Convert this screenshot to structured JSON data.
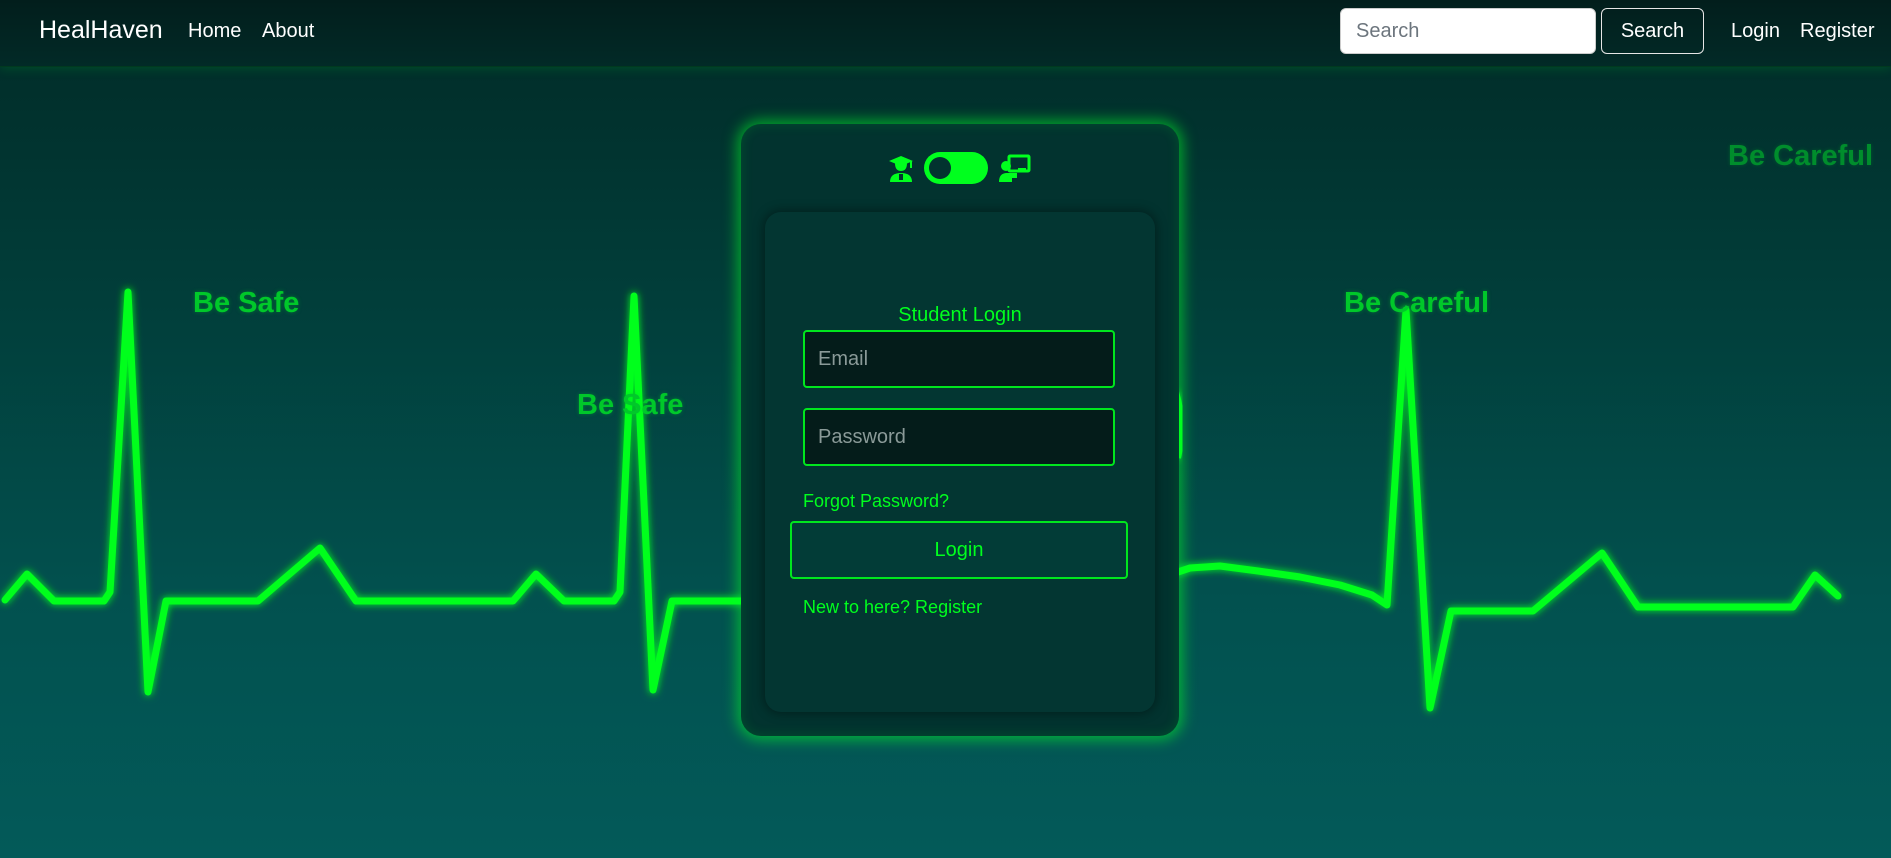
{
  "navbar": {
    "brand": "HealHaven",
    "links": [
      {
        "label": "Home"
      },
      {
        "label": "About"
      }
    ],
    "search": {
      "placeholder": "Search",
      "button_label": "Search"
    },
    "auth": {
      "login_label": "Login",
      "register_label": "Register"
    }
  },
  "background": {
    "words": [
      "Be Safe",
      "Be Safe",
      "Be Careful",
      "Be Careful"
    ]
  },
  "login_card": {
    "title": "Student Login",
    "email_placeholder": "Email",
    "password_placeholder": "Password",
    "forgot_label": "Forgot Password?",
    "login_label": "Login",
    "register_label": "New to here? Register",
    "toggle": {
      "left_icon": "student-icon",
      "right_icon": "teacher-icon",
      "state": "student"
    }
  },
  "colors": {
    "accent": "#00ff1e",
    "card": "#02332f",
    "navbar": "#022a27"
  }
}
